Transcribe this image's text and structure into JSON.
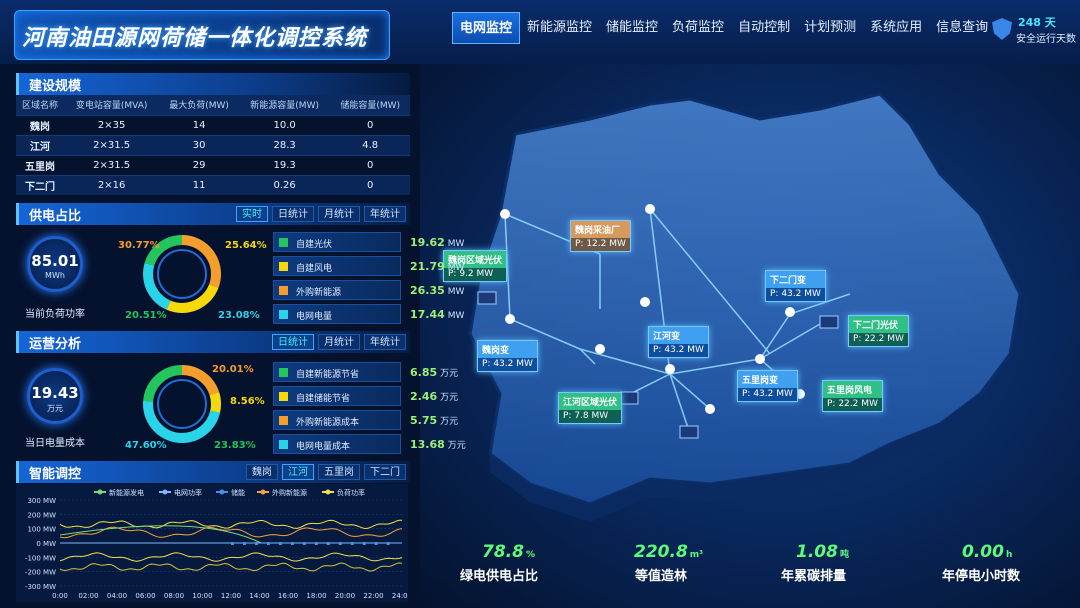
{
  "header": {
    "title": "河南油田源网荷储一体化调控系统",
    "nav": [
      "电网监控",
      "新能源监控",
      "储能监控",
      "负荷监控",
      "自动控制",
      "计划预测",
      "系统应用",
      "信息查询"
    ],
    "active_nav": "电网监控",
    "safe_days": "248 天",
    "safe_label": "安全运行天数"
  },
  "construction": {
    "title": "建设规模",
    "headers": [
      "区域名称",
      "变电站容量(MVA)",
      "最大负荷(MW)",
      "新能源容量(MW)",
      "储能容量(MW)"
    ],
    "rows": [
      [
        "魏岗",
        "2×35",
        "14",
        "10.0",
        "0"
      ],
      [
        "江河",
        "2×31.5",
        "30",
        "28.3",
        "4.8"
      ],
      [
        "五里岗",
        "2×31.5",
        "29",
        "19.3",
        "0"
      ],
      [
        "下二门",
        "2×16",
        "11",
        "0.26",
        "0"
      ]
    ]
  },
  "supply": {
    "title": "供电占比",
    "tabs": [
      "实时",
      "日统计",
      "月统计",
      "年统计"
    ],
    "active_tab": "实时",
    "kpi_value": "85.01",
    "kpi_unit": "MWh",
    "kpi_label": "当前负荷功率",
    "ring_pcts": [
      "30.77%",
      "25.64%",
      "20.51%",
      "23.08%"
    ],
    "legend": [
      {
        "label": "自建光伏",
        "value": "19.62",
        "unit": "MW",
        "color": "#22c55e"
      },
      {
        "label": "自建风电",
        "value": "21.79",
        "unit": "MW",
        "color": "#f5d90a"
      },
      {
        "label": "外购新能源",
        "value": "26.35",
        "unit": "MW",
        "color": "#f59e2b"
      },
      {
        "label": "电网电量",
        "value": "17.44",
        "unit": "MW",
        "color": "#2ad4e8"
      }
    ]
  },
  "ops": {
    "title": "运营分析",
    "tabs": [
      "日统计",
      "月统计",
      "年统计"
    ],
    "active_tab": "日统计",
    "kpi_value": "19.43",
    "kpi_unit": "万元",
    "kpi_label": "当日电量成本",
    "ring_pcts": [
      "20.01%",
      "8.56%",
      "47.60%",
      "23.83%"
    ],
    "legend": [
      {
        "label": "自建新能源节省",
        "value": "6.85",
        "unit": "万元",
        "color": "#22c55e"
      },
      {
        "label": "自建储能节省",
        "value": "2.46",
        "unit": "万元",
        "color": "#f5d90a"
      },
      {
        "label": "外购新能源成本",
        "value": "5.75",
        "unit": "万元",
        "color": "#f59e2b"
      },
      {
        "label": "电网电量成本",
        "value": "13.68",
        "unit": "万元",
        "color": "#2ad4e8"
      }
    ]
  },
  "smart": {
    "title": "智能调控",
    "tabs": [
      "魏岗",
      "江河",
      "五里岗",
      "下二门"
    ],
    "active_tab": "江河"
  },
  "chart_data": {
    "type": "line",
    "series": [
      {
        "name": "新能源发电",
        "color": "#7ed87a"
      },
      {
        "name": "电网功率",
        "color": "#7fb6ff"
      },
      {
        "name": "储能",
        "color": "#4a8fe6"
      },
      {
        "name": "外购新能源",
        "color": "#f5a33b"
      },
      {
        "name": "负荷功率",
        "color": "#f5e04a"
      }
    ],
    "y_ticks": [
      "300 MW",
      "200 MW",
      "100 MW",
      "0 MW",
      "-100 MW",
      "-200 MW",
      "-300 MW"
    ],
    "x_ticks": [
      "0:00",
      "02:00",
      "04:00",
      "06:00",
      "08:00",
      "10:00",
      "12:00",
      "14:00",
      "16:00",
      "18:00",
      "20:00",
      "22:00",
      "24:00"
    ],
    "ylim": [
      -300,
      300
    ]
  },
  "map": {
    "labels": [
      {
        "name": "魏岗区域光伏",
        "p": "P: 9.2 MW",
        "style": "green"
      },
      {
        "name": "魏岗采油厂",
        "p": "P: 12.2 MW",
        "style": "orange"
      },
      {
        "name": "魏岗变",
        "p": "P: 43.2 MW",
        "style": "blue"
      },
      {
        "name": "江河变",
        "p": "P: 43.2 MW",
        "style": "blue"
      },
      {
        "name": "江河区域光伏",
        "p": "P: 7.8 MW",
        "style": "green"
      },
      {
        "name": "下二门变",
        "p": "P: 43.2 MW",
        "style": "blue"
      },
      {
        "name": "下二门光伏",
        "p": "P: 22.2 MW",
        "style": "green"
      },
      {
        "name": "五里岗变",
        "p": "P: 43.2 MW",
        "style": "blue"
      },
      {
        "name": "五里岗风电",
        "p": "P: 22.2 MW",
        "style": "green"
      }
    ]
  },
  "stats": [
    {
      "value": "78.8",
      "unit": "%",
      "label": "绿电供电占比"
    },
    {
      "value": "220.8",
      "unit": "m³",
      "label": "等值造林"
    },
    {
      "value": "1.08",
      "unit": "吨",
      "label": "年累碳排量"
    },
    {
      "value": "0.00",
      "unit": "h",
      "label": "年停电小时数"
    }
  ]
}
